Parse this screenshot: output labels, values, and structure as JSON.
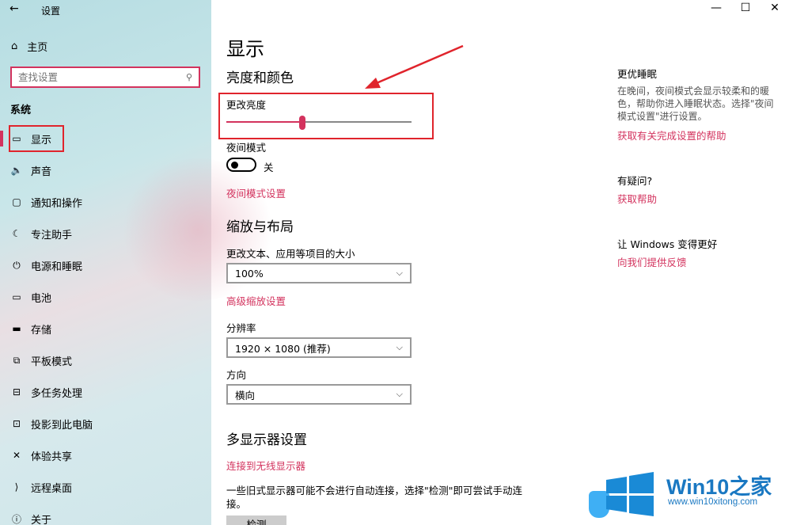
{
  "window": {
    "title": "设置",
    "back_icon": "←",
    "minimize": "—",
    "maximize": "☐",
    "close": "✕"
  },
  "sidebar": {
    "home_icon": "⌂",
    "home_label": "主页",
    "search_placeholder": "查找设置",
    "search_icon": "⚲",
    "section": "系统",
    "items": [
      {
        "icon": "▭",
        "label": "显示",
        "active": true
      },
      {
        "icon": "🔈",
        "label": "声音"
      },
      {
        "icon": "▢",
        "label": "通知和操作"
      },
      {
        "icon": "☾",
        "label": "专注助手"
      },
      {
        "icon": "⏻",
        "label": "电源和睡眠"
      },
      {
        "icon": "▭",
        "label": "电池"
      },
      {
        "icon": "▬",
        "label": "存储"
      },
      {
        "icon": "⧉",
        "label": "平板模式"
      },
      {
        "icon": "⊟",
        "label": "多任务处理"
      },
      {
        "icon": "⊡",
        "label": "投影到此电脑"
      },
      {
        "icon": "✕",
        "label": "体验共享"
      },
      {
        "icon": "⟩",
        "label": "远程桌面"
      },
      {
        "icon": "ⓘ",
        "label": "关于"
      }
    ]
  },
  "main": {
    "title": "显示",
    "brightness_heading": "亮度和颜色",
    "brightness_label": "更改亮度",
    "brightness_level": 0.41,
    "night_label": "夜间模式",
    "night_state": "关",
    "night_link": "夜间模式设置",
    "scale_heading": "缩放与布局",
    "scale_label": "更改文本、应用等项目的大小",
    "scale_value": "100%",
    "advanced_scale_link": "高级缩放设置",
    "resolution_label": "分辨率",
    "resolution_value": "1920 × 1080 (推荐)",
    "orientation_label": "方向",
    "orientation_value": "横向",
    "multi_heading": "多显示器设置",
    "wireless_link": "连接到无线显示器",
    "multi_desc": "一些旧式显示器可能不会进行自动连接，选择\"检测\"即可尝试手动连接。",
    "detect_button": "检测",
    "chevron": "⌵"
  },
  "right": {
    "sleep_heading": "更优睡眠",
    "sleep_text": "在晚间，夜间模式会显示较柔和的暖色，帮助你进入睡眠状态。选择\"夜间模式设置\"进行设置。",
    "sleep_link": "获取有关完成设置的帮助",
    "question_heading": "有疑问?",
    "question_link": "获取帮助",
    "improve_heading": "让 Windows 变得更好",
    "improve_link": "向我们提供反馈"
  },
  "watermark": {
    "brand": "Win10",
    "brand_cn": "之家",
    "url": "www.win10xitong.com"
  },
  "colors": {
    "accent": "#d3335e",
    "annotation_red": "#e0242c",
    "watermark_blue": "#1a78c2"
  }
}
